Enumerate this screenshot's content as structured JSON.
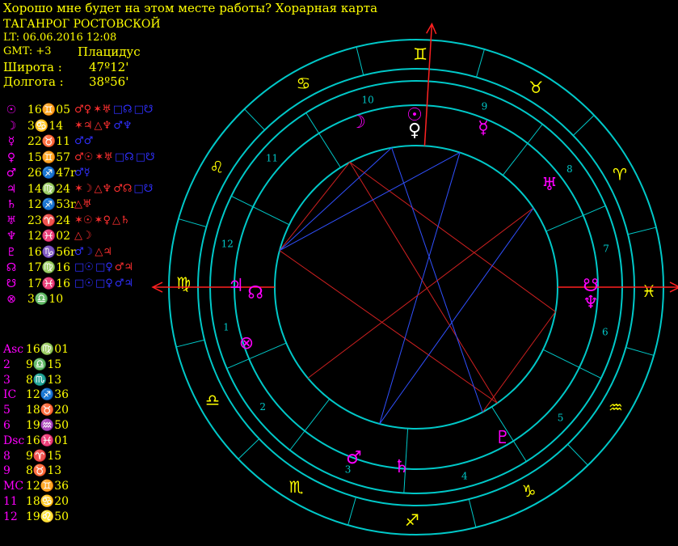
{
  "header": {
    "title": "Хорошо мне будет на этом месте работы? Хорарная карта",
    "city": "ТАГАНРОГ РОСТОВСКОЙ",
    "lt": "LT: 06.06.2016  12:08",
    "gmt": "GMT: +3",
    "system": "Плацидус",
    "lat_label": "Широта :",
    "lat_value": "47º12'",
    "lon_label": "Долгота :",
    "lon_value": "38º56'"
  },
  "planets": [
    {
      "symbol": "☉",
      "name": "sun",
      "position": "16♊05",
      "aspects": [
        [
          "♂♀",
          "#ff3030"
        ],
        [
          "✶♅",
          "#ff3030"
        ],
        [
          "□☊",
          "#3030ff"
        ],
        [
          "□☋",
          "#3030ff"
        ]
      ]
    },
    {
      "symbol": "☽",
      "name": "moon",
      "position": "3♋14",
      "aspects": [
        [
          "✶♃",
          "#ff3030"
        ],
        [
          "△♆",
          "#ff3030"
        ],
        [
          "♂♆",
          "#3030ff"
        ]
      ]
    },
    {
      "symbol": "☿",
      "name": "mercury",
      "position": "22♉11",
      "aspects": [
        [
          "♂♂",
          "#3030ff"
        ]
      ]
    },
    {
      "symbol": "♀",
      "name": "venus",
      "position": "15♊57",
      "aspects": [
        [
          "♂☉",
          "#ff3030"
        ],
        [
          "✶♅",
          "#ff3030"
        ],
        [
          "□☊",
          "#3030ff"
        ],
        [
          "□☋",
          "#3030ff"
        ]
      ]
    },
    {
      "symbol": "♂",
      "name": "mars",
      "position": "26♐47r",
      "aspects": [
        [
          "♂☿",
          "#3030ff"
        ]
      ]
    },
    {
      "symbol": "♃",
      "name": "jupiter",
      "position": "14♍24",
      "aspects": [
        [
          "✶☽",
          "#ff3030"
        ],
        [
          "△♆",
          "#ff3030"
        ],
        [
          "♂☊",
          "#ff3030"
        ],
        [
          "□☋",
          "#3030ff"
        ]
      ]
    },
    {
      "symbol": "♄",
      "name": "saturn",
      "position": "12♐53r",
      "aspects": [
        [
          "△♅",
          "#ff3030"
        ]
      ]
    },
    {
      "symbol": "♅",
      "name": "uranus",
      "position": "23♈24",
      "aspects": [
        [
          "✶☉",
          "#ff3030"
        ],
        [
          "✶♀",
          "#ff3030"
        ],
        [
          "△♄",
          "#ff3030"
        ]
      ]
    },
    {
      "symbol": "♆",
      "name": "neptune",
      "position": "12♓02",
      "aspects": [
        [
          "△☽",
          "#ff3030"
        ]
      ]
    },
    {
      "symbol": "♇",
      "name": "pluto",
      "position": "16♑56r",
      "aspects": [
        [
          "♂☽",
          "#3030ff"
        ],
        [
          "△♃",
          "#ff3030"
        ]
      ]
    },
    {
      "symbol": "☊",
      "name": "north-node",
      "position": "17♍16",
      "aspects": [
        [
          "□☉",
          "#3030ff"
        ],
        [
          "□♀",
          "#3030ff"
        ],
        [
          "♂♃",
          "#ff3030"
        ]
      ]
    },
    {
      "symbol": "☋",
      "name": "south-node",
      "position": "17♓16",
      "aspects": [
        [
          "□☉",
          "#3030ff"
        ],
        [
          "□♀",
          "#3030ff"
        ],
        [
          "♂♃",
          "#3030ff"
        ]
      ]
    },
    {
      "symbol": "⊗",
      "name": "part-of-fortune",
      "position": "3♎10",
      "aspects": []
    }
  ],
  "houses": [
    {
      "label": "Asc",
      "value": "16♍01"
    },
    {
      "label": "2",
      "value": "9♎15"
    },
    {
      "label": "3",
      "value": "8♏13"
    },
    {
      "label": "IC",
      "value": "12♐36"
    },
    {
      "label": "5",
      "value": "18♉20"
    },
    {
      "label": "6",
      "value": "19♒50"
    },
    {
      "label": "Dsc",
      "value": "16♓01"
    },
    {
      "label": "8",
      "value": "9♈15"
    },
    {
      "label": "9",
      "value": "8♉13"
    },
    {
      "label": "MC",
      "value": "12♊36"
    },
    {
      "label": "11",
      "value": "18♋20"
    },
    {
      "label": "12",
      "value": "19♌50"
    }
  ],
  "wheel": {
    "asc": "16♍01",
    "zodiac_ring": [
      "♍",
      "♌",
      "♋",
      "♊",
      "♉",
      "♈",
      "♓",
      "♒",
      "♑",
      "♐",
      "♏",
      "♎"
    ],
    "zodiac_names": [
      "virgo",
      "leo",
      "cancer",
      "gemini",
      "taurus",
      "aries",
      "pisces",
      "aquarius",
      "capricorn",
      "sagittarius",
      "scorpio",
      "libra"
    ],
    "house_numbers": [
      "1",
      "2",
      "3",
      "4",
      "5",
      "6",
      "7",
      "8",
      "9",
      "10",
      "11",
      "12"
    ],
    "planet_glyphs": [
      {
        "name": "sun",
        "glyph": "☉",
        "color": "#ff00ff"
      },
      {
        "name": "venus",
        "glyph": "♀",
        "color": "#ffffff"
      },
      {
        "name": "moon",
        "glyph": "☽",
        "color": "#ff00ff"
      },
      {
        "name": "mercury",
        "glyph": "☿",
        "color": "#ff00ff"
      },
      {
        "name": "uranus",
        "glyph": "♅",
        "color": "#ff00ff"
      },
      {
        "name": "south-node",
        "glyph": "☋",
        "color": "#ff00ff"
      },
      {
        "name": "neptune",
        "glyph": "♆",
        "color": "#ff00ff"
      },
      {
        "name": "pluto",
        "glyph": "♇",
        "color": "#ff00ff"
      },
      {
        "name": "saturn",
        "glyph": "♄",
        "color": "#ff00ff"
      },
      {
        "name": "mars",
        "glyph": "♂",
        "color": "#ff00ff"
      },
      {
        "name": "part-of-fortune",
        "glyph": "⊗",
        "color": "#ff00ff"
      },
      {
        "name": "north-node",
        "glyph": "☊",
        "color": "#ff00ff"
      },
      {
        "name": "jupiter",
        "glyph": "♃",
        "color": "#ff00ff"
      }
    ]
  },
  "colors": {
    "background": "#000000",
    "ring": "#00c8c8",
    "zodiac": "#ffff00",
    "planet": "#ff00ff",
    "axis": "#ff2020",
    "aspect_red": "#d02020",
    "aspect_blue": "#3050ff"
  }
}
